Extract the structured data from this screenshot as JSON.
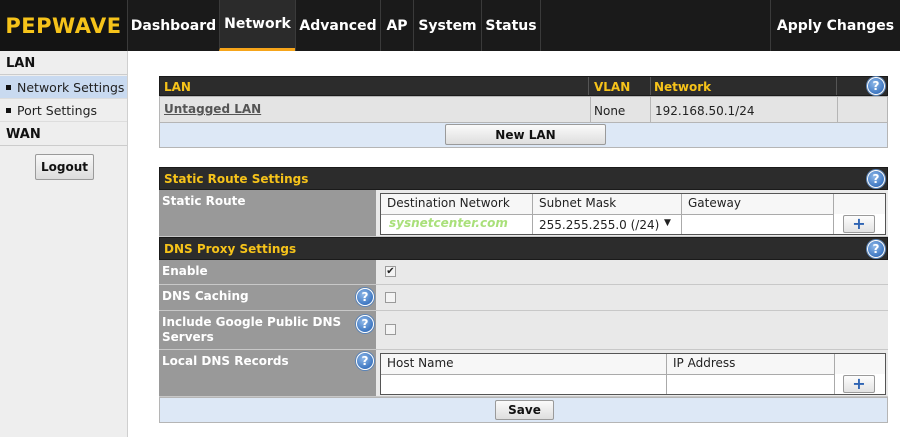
{
  "brand": "PEPWAVE",
  "nav": {
    "tabs": [
      "Dashboard",
      "Network",
      "Advanced",
      "AP",
      "System",
      "Status"
    ],
    "active": "Network",
    "apply_changes": "Apply Changes"
  },
  "sidebar": {
    "lan_heading": "LAN",
    "items": [
      "Network Settings",
      "Port Settings"
    ],
    "active_item": "Network Settings",
    "wan_heading": "WAN",
    "logout": "Logout"
  },
  "lan_table": {
    "headers": {
      "lan": "LAN",
      "vlan": "VLAN",
      "network": "Network"
    },
    "rows": [
      {
        "lan": "Untagged LAN",
        "vlan": "None",
        "network": "192.168.50.1/24"
      }
    ],
    "new_lan_button": "New LAN"
  },
  "static_route": {
    "section_title": "Static Route Settings",
    "row_label": "Static Route",
    "columns": [
      "Destination Network",
      "Subnet Mask",
      "Gateway"
    ],
    "subnet_mask_value": "255.255.255.0 (/24)",
    "destination_value": "",
    "gateway_value": ""
  },
  "dns_proxy": {
    "section_title": "DNS Proxy Settings",
    "enable_label": "Enable",
    "enable_checked": true,
    "dns_caching_label": "DNS Caching",
    "dns_caching_checked": false,
    "google_dns_label": "Include Google Public DNS Servers",
    "google_dns_checked": false,
    "local_dns_label": "Local DNS Records",
    "local_dns_columns": [
      "Host Name",
      "IP Address"
    ],
    "save_button": "Save"
  },
  "watermark": "sysnetcenter.com",
  "icons": {
    "help": "?",
    "add": "+",
    "check": "✔",
    "dropdown": "▼"
  },
  "colors": {
    "accent": "#f6c31a",
    "active_tab_underline": "#f6a51a",
    "sidebar_active": "#c9daf0",
    "help_blue": "#3f78c2"
  }
}
